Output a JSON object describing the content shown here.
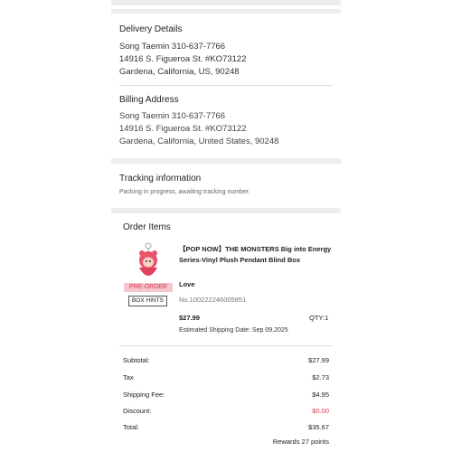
{
  "delivery": {
    "title": "Delivery Details",
    "name_phone": "Song Taemin 310-637-7766",
    "street": "14916  S. Figueroa St. #KO73122",
    "city": "Gardena, California, US, 90248"
  },
  "billing": {
    "title": "Billing Address",
    "name_phone": "Song Taemin 310-637-7766",
    "street": "14916  S. Figueroa St. #KO73122",
    "city": "Gardena, California, United States, 90248"
  },
  "tracking": {
    "title": "Tracking information",
    "status": "Packing in progress, awaiting tracking number."
  },
  "order_items": {
    "title": "Order Items",
    "item": {
      "badge": "PRE-ORDER",
      "hints_button": "BOX HINTS",
      "name": "【POP NOW】THE MONSTERS Big into Energy Series-Vinyl Plush Pendant Blind Box",
      "variant": "Love",
      "sku": "No.100222246005851",
      "price": "$27.99",
      "qty": "QTY:1",
      "ship_date": "Estimated Shipping Date: Sep 09,2025",
      "thumb_icon": "plush-pendant-image"
    }
  },
  "summary": {
    "rows": [
      {
        "label": "Subtotal:",
        "value": "$27.99"
      },
      {
        "label": "Tax",
        "value": "$2.73"
      },
      {
        "label": "Shipping Fee:",
        "value": "$4.95"
      },
      {
        "label": "Discount:",
        "value": "$0.00"
      },
      {
        "label": "Total:",
        "value": "$35.67"
      }
    ],
    "rewards": "Rewards 27 points",
    "discount_color": "#d23b52"
  }
}
